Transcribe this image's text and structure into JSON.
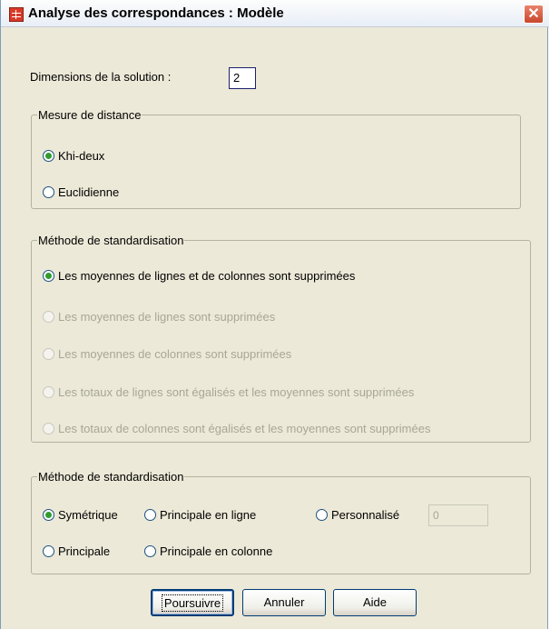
{
  "window": {
    "title": "Analyse des correspondances : Modèle",
    "close_symbol": "✕"
  },
  "dimensions": {
    "label": "Dimensions de la solution :",
    "value": "2"
  },
  "distance": {
    "legend": "Mesure de distance",
    "options": [
      {
        "label": "Khi-deux",
        "checked": true,
        "enabled": true
      },
      {
        "label": "Euclidienne",
        "checked": false,
        "enabled": true
      }
    ]
  },
  "standardization": {
    "legend": "Méthode de standardisation",
    "options": [
      {
        "label": "Les moyennes de lignes et de colonnes sont supprimées",
        "checked": true,
        "enabled": true
      },
      {
        "label": "Les moyennes de lignes sont supprimées",
        "checked": false,
        "enabled": false
      },
      {
        "label": "Les moyennes de colonnes sont supprimées",
        "checked": false,
        "enabled": false
      },
      {
        "label": "Les totaux de lignes sont égalisés et les moyennes sont supprimées",
        "checked": false,
        "enabled": false
      },
      {
        "label": "Les totaux de colonnes sont égalisés et les moyennes sont supprimées",
        "checked": false,
        "enabled": false
      }
    ]
  },
  "normalization": {
    "legend": "Méthode de standardisation",
    "options": {
      "symmetric": "Symétrique",
      "row_principal": "Principale en ligne",
      "custom": "Personnalisé",
      "principal": "Principale",
      "column_principal": "Principale en colonne"
    },
    "selected": "symmetric",
    "custom_value": "0"
  },
  "buttons": {
    "continue": "Poursuivre",
    "cancel": "Annuler",
    "help": "Aide"
  },
  "colors": {
    "dialog_bg": "#ECE9D8",
    "radio_selected": "#2e9d2e",
    "disabled_text": "#a7a698"
  }
}
